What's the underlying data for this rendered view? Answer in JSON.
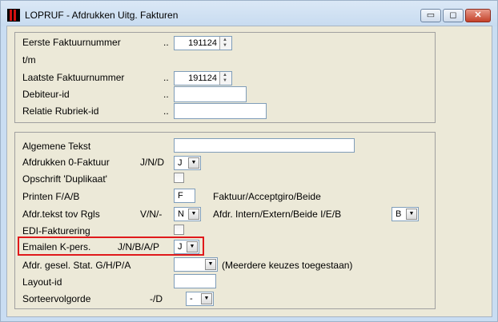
{
  "window": {
    "title": "LOPRUF - Afdrukken Uitg. Fakturen",
    "minimize_glyph": "▭",
    "restore_glyph": "◻",
    "close_glyph": "✕"
  },
  "group1": {
    "eerste_label": "Eerste  Faktuurnummer",
    "eerste_dots": "..",
    "eerste_value": "191124",
    "tm_label": "t/m",
    "laatste_label": "Laatste Faktuurnummer",
    "laatste_dots": "..",
    "laatste_value": "191124",
    "debiteur_label": "Debiteur-id",
    "debiteur_dots": "..",
    "debiteur_value": "",
    "relatie_label": "Relatie Rubriek-id",
    "relatie_dots": "..",
    "relatie_value": ""
  },
  "group2": {
    "algemene_label": "Algemene Tekst",
    "algemene_value": "",
    "nul_faktuur_label": "Afdrukken 0-Faktuur",
    "nul_faktuur_options": "J/N/D",
    "nul_faktuur_value": "J",
    "duplikaat_label": "Opschrift 'Duplikaat'",
    "duplikaat_checked": false,
    "printen_label": "Printen F/A/B",
    "printen_value": "F",
    "printen_hint": "Faktuur/Acceptgiro/Beide",
    "afdr_tekst_label": "Afdr.tekst tov Rgls",
    "afdr_tekst_options": "V/N/-",
    "afdr_tekst_value": "N",
    "afdr_intern_label": "Afdr. Intern/Extern/Beide I/E/B",
    "afdr_intern_value": "B",
    "edi_label": "EDI-Fakturering",
    "edi_checked": false,
    "emailen_label": "Emailen K-pers.",
    "emailen_options": "J/N/B/A/P",
    "emailen_value": "J",
    "gesel_label": "Afdr. gesel. Stat. G/H/P/A",
    "gesel_value": "",
    "gesel_hint": "(Meerdere keuzes toegestaan)",
    "layout_label": "Layout-id",
    "layout_value": "",
    "sorteer_label": "Sorteervolgorde",
    "sorteer_options": "-/D",
    "sorteer_value": "-"
  },
  "icons": {
    "spin_up": "▲",
    "spin_down": "▼",
    "dropdown_arrow": "▼"
  }
}
